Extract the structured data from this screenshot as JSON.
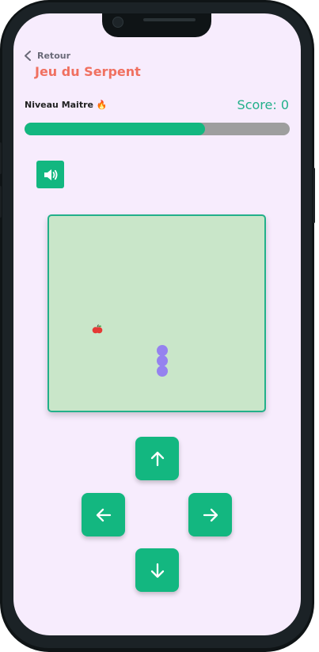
{
  "header": {
    "back_label": "Retour",
    "title": "Jeu du Serpent"
  },
  "status": {
    "level_label": "Niveau Maitre 🔥",
    "score_label": "Score: 0",
    "progress_fraction": 0.68
  },
  "controls": {
    "sound_icon": "speaker-volume-icon",
    "up_icon": "arrow-up-icon",
    "left_icon": "arrow-left-icon",
    "right_icon": "arrow-right-icon",
    "down_icon": "arrow-down-icon"
  },
  "game": {
    "food": "apple",
    "snake_length": 3,
    "snake_direction": "vertical"
  },
  "colors": {
    "accent": "#13b780",
    "title": "#f07060",
    "score": "#22b08a",
    "board_bg": "#c9e6c9",
    "snake": "#9582ef",
    "food": "#e53935",
    "background": "#f7ecfd"
  }
}
